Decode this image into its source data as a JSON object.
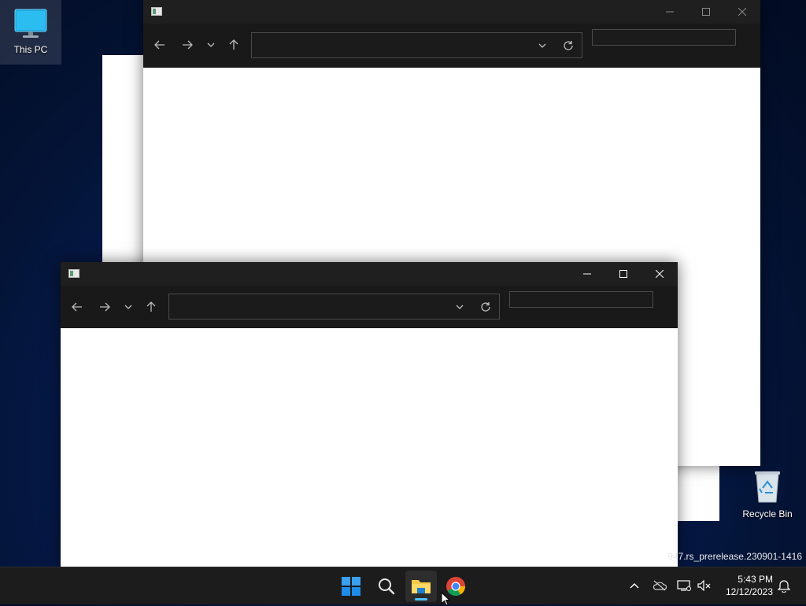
{
  "desktop": {
    "icons": [
      {
        "label": "This PC",
        "icon": "monitor-icon"
      },
      {
        "label": "Recycle Bin",
        "icon": "recycle-bin-icon"
      }
    ],
    "watermark": "947.rs_prerelease.230901-1416"
  },
  "windows": [
    {
      "title": "",
      "address": {
        "value": "",
        "placeholder": ""
      },
      "search": {
        "value": "",
        "placeholder": ""
      },
      "buttons": {
        "minimize": "minimize-icon",
        "maximize": "maximize-icon",
        "close": "close-icon"
      }
    },
    {
      "title": "",
      "address": {
        "value": "",
        "placeholder": ""
      },
      "search": {
        "value": "",
        "placeholder": ""
      },
      "buttons": {
        "minimize": "minimize-icon",
        "maximize": "maximize-icon",
        "close": "close-icon"
      }
    }
  ],
  "taskbar": {
    "apps": [
      {
        "name": "Start",
        "icon": "windows-logo-icon"
      },
      {
        "name": "Search",
        "icon": "search-icon"
      },
      {
        "name": "File Explorer",
        "icon": "folder-icon",
        "running": true
      },
      {
        "name": "Google Chrome",
        "icon": "chrome-icon"
      }
    ],
    "tray": [
      "chevron-up-icon",
      "onedrive-icon",
      "network-icon",
      "volume-muted-icon",
      "notification-bell-icon"
    ],
    "time": "5:43 PM",
    "date": "12/12/2023"
  },
  "colors": {
    "titlebar": "#1f1f1f",
    "toolbar": "#191919",
    "accent": "#0078d4",
    "chrome_red": "#db4437",
    "chrome_green": "#0f9d58",
    "chrome_yellow": "#f4b400",
    "chrome_blue": "#4285f4"
  }
}
